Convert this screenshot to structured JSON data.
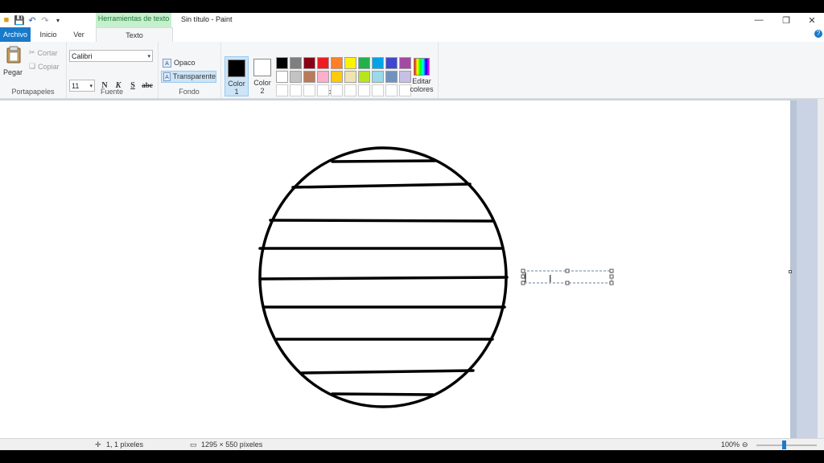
{
  "window": {
    "title": "Sin título - Paint",
    "context_tab": "Herramientas de texto"
  },
  "tabs": [
    {
      "label": "Archivo"
    },
    {
      "label": "Inicio"
    },
    {
      "label": "Ver"
    },
    {
      "label": "Texto"
    }
  ],
  "clipboard": {
    "paste": "Pegar",
    "cut": "Cortar",
    "copy": "Copiar",
    "group": "Portapapeles"
  },
  "font": {
    "family": "Calibri",
    "size": "11",
    "bold": "N",
    "italic": "K",
    "underline": "S",
    "strike": "abc",
    "group": "Fuente"
  },
  "background": {
    "opaque": "Opaco",
    "transparent": "Transparente",
    "group": "Fondo"
  },
  "colors": {
    "color1_label_a": "Color",
    "color1_label_b": "1",
    "color2_label_a": "Color",
    "color2_label_b": "2",
    "color1": "#000000",
    "color2": "#ffffff",
    "edit_label_a": "Editar",
    "edit_label_b": "colores",
    "group": "Colores",
    "palette": [
      "#000000",
      "#7f7f7f",
      "#880015",
      "#ed1c24",
      "#ff7f27",
      "#fff200",
      "#22b14c",
      "#00a2e8",
      "#3f48cc",
      "#a349a4",
      "#ffffff",
      "#c3c3c3",
      "#b97a57",
      "#ffaec9",
      "#ffc90e",
      "#efe4b0",
      "#b5e61d",
      "#99d9ea",
      "#7092be",
      "#c8bfe7",
      "#ffffff",
      "#ffffff",
      "#ffffff",
      "#ffffff",
      "#ffffff",
      "#ffffff",
      "#ffffff",
      "#ffffff",
      "#ffffff",
      "#ffffff"
    ]
  },
  "status": {
    "cursor_pos": "1, 1 píxeles",
    "canvas_size": "1295 × 550 píxeles",
    "zoom": "100%"
  }
}
